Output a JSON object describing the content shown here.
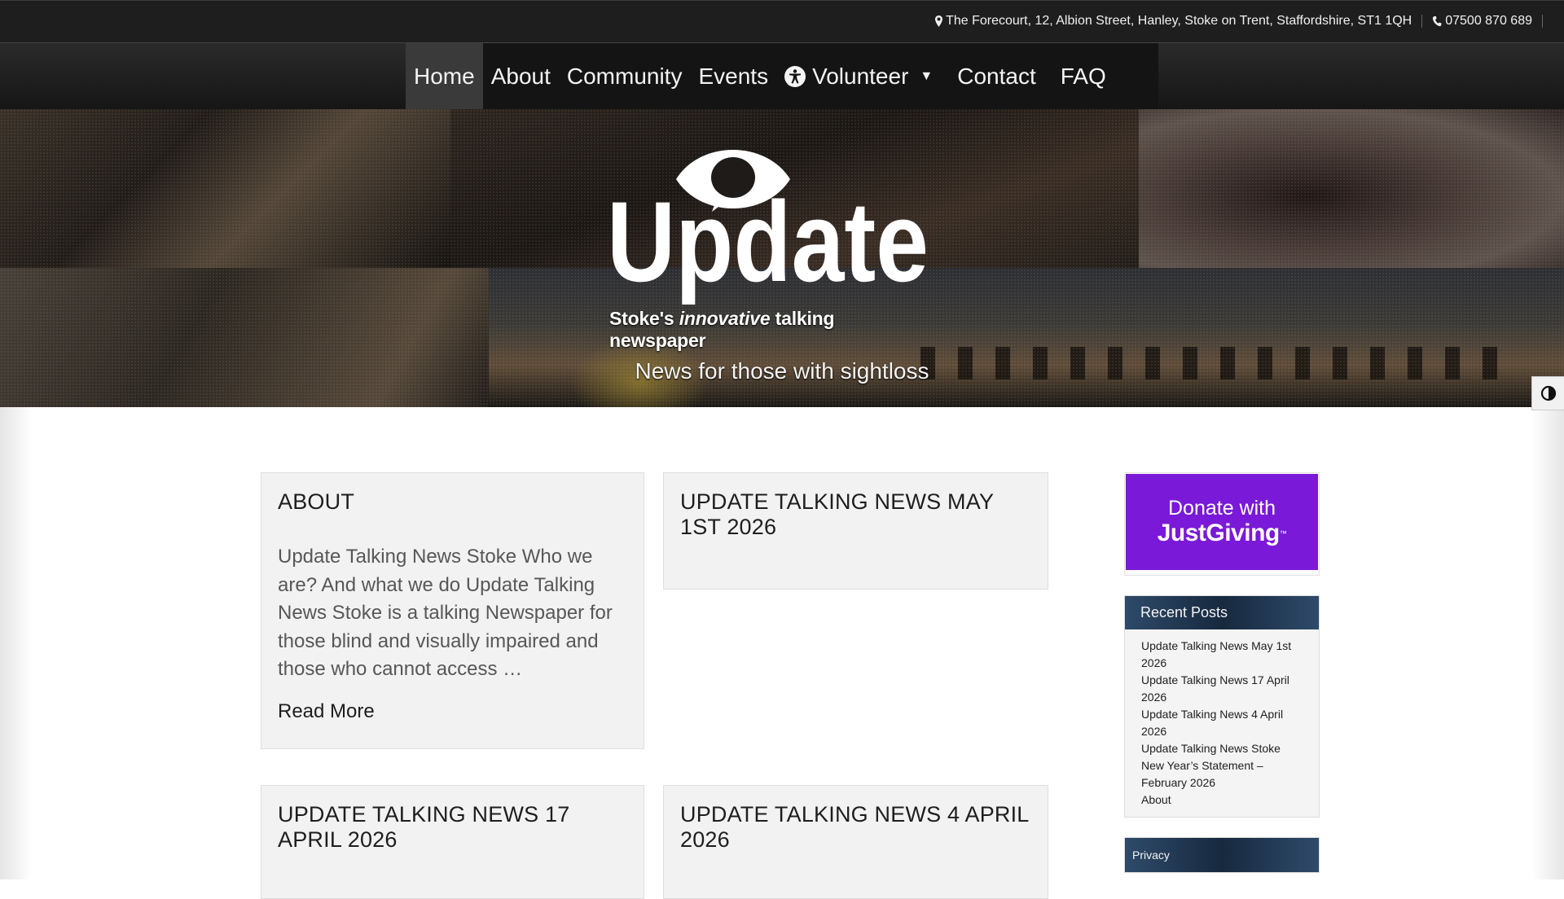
{
  "topbar": {
    "address": "The Forecourt, 12, Albion Street, Hanley, Stoke on Trent, Staffordshire, ST1 1QH",
    "phone": "07500 870 689",
    "address_icon": "map-marker-icon",
    "phone_icon": "phone-icon"
  },
  "nav": {
    "items": [
      {
        "label": "Home",
        "active": true
      },
      {
        "label": "About"
      },
      {
        "label": "Community"
      },
      {
        "label": "Events"
      },
      {
        "label": "Volunteer",
        "icon": "accessibility-icon",
        "has_dropdown": true
      },
      {
        "label": "Contact"
      },
      {
        "label": "FAQ"
      }
    ]
  },
  "hero": {
    "logo_text": "Update",
    "tagline_pre": "Stoke's ",
    "tagline_em": "innovative",
    "tagline_post": " talking newspaper",
    "subtitle": "News for those with sightloss"
  },
  "posts": [
    {
      "title": "ABOUT",
      "excerpt": "Update Talking News Stoke Who we are? And what we do Update Talking News Stoke is a talking Newspaper for those blind and visually impaired and those who cannot access …",
      "more": "Read More"
    },
    {
      "title": "UPDATE TALKING NEWS MAY 1ST 2026"
    },
    {
      "title": "UPDATE TALKING NEWS 17 APRIL 2026"
    },
    {
      "title": "UPDATE TALKING NEWS 4 APRIL 2026"
    }
  ],
  "sidebar": {
    "donate": {
      "line1": "Donate with",
      "line2": "JustGiving",
      "tm": "™",
      "color": "#7a19d8"
    },
    "recent_posts": {
      "heading": "Recent Posts",
      "items": [
        "Update Talking News May 1st 2026",
        "Update Talking News 17 April 2026",
        "Update Talking News 4 April 2026",
        "Update Talking News Stoke New Year’s Statement – February 2026",
        "About"
      ]
    },
    "privacy": {
      "heading": "Privacy"
    }
  },
  "contrast_toggle": {
    "icon": "contrast-icon"
  },
  "colors": {
    "topbar": "#1e1e1e",
    "nav": "#141414",
    "widget_header": "#1f3550",
    "card": "#f2f2f2"
  }
}
